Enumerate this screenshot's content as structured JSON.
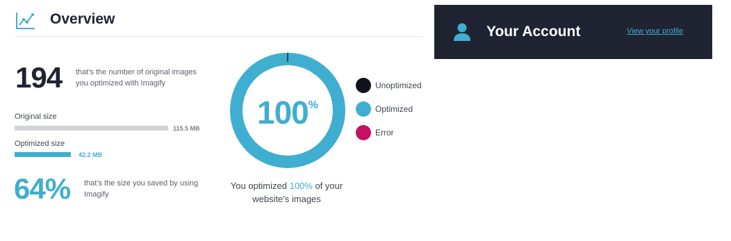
{
  "overview": {
    "title": "Overview",
    "icon": "chart-line-icon",
    "images_count": "194",
    "images_desc": "that's the number of original images you optimized with Imagify",
    "original_size": {
      "label": "Original size",
      "value": "115.5 MB",
      "fill_fraction": 1.0,
      "color": "#d2d3d6"
    },
    "optimized_size": {
      "label": "Optimized size",
      "value": "42.2 MB",
      "fill_fraction": 0.365,
      "color": "#40aed0"
    },
    "saved_percent": "64%",
    "saved_desc": "that's the size you saved by using Imagify"
  },
  "donut": {
    "value": "100",
    "unit": "%",
    "optimized_fraction": 1.0,
    "caption_before": "You optimized ",
    "caption_highlight": "100%",
    "caption_after": " of your website's images"
  },
  "legend": [
    {
      "label": "Unoptimized",
      "color": "#10121a"
    },
    {
      "label": "Optimized",
      "color": "#40aed0"
    },
    {
      "label": "Error",
      "color": "#c51162"
    }
  ],
  "account": {
    "title": "Your Account",
    "link": "View your profile",
    "icon": "user-icon"
  },
  "colors": {
    "accent": "#40aed0",
    "dark": "#1f2332"
  }
}
